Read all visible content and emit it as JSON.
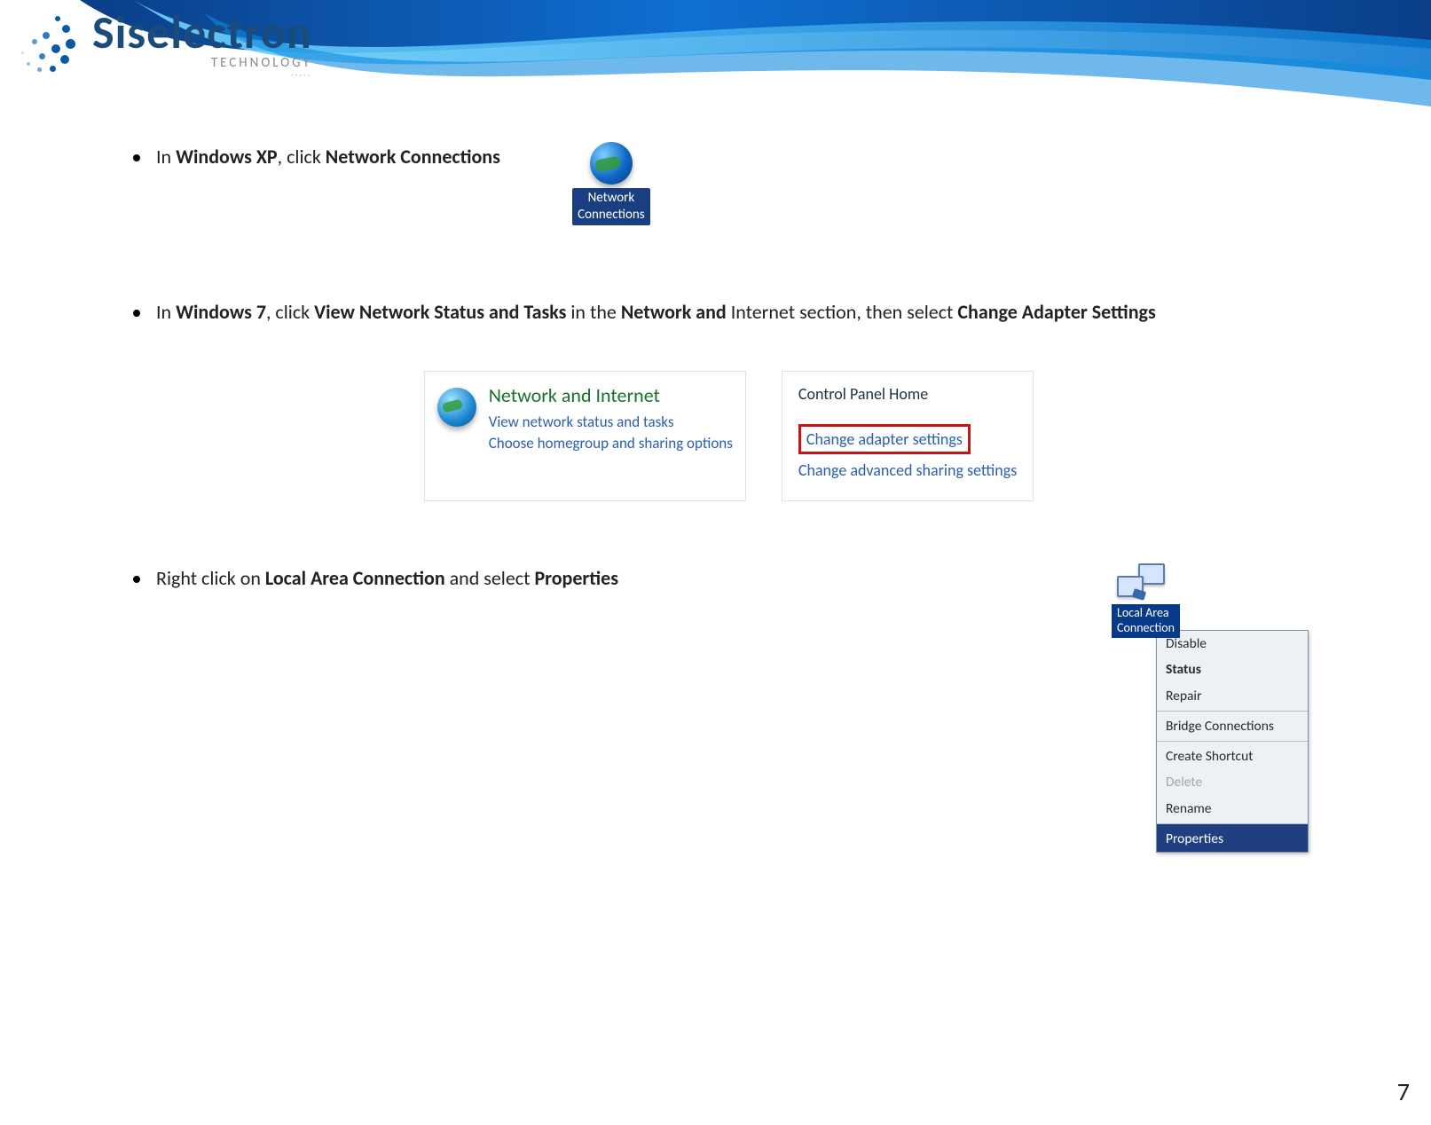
{
  "brand": {
    "name": "Siselectron",
    "sub": "TECHNOLOGY",
    "dots": "·····"
  },
  "bullet1": {
    "pre": "In ",
    "os": "Windows XP",
    "mid": ", click ",
    "target": "Network Connections"
  },
  "xp_icon": {
    "label": "Network\nConnections"
  },
  "bullet2": {
    "pre": "In ",
    "os": "Windows 7",
    "mid1": ", click ",
    "b1": "View Network Status and Tasks",
    "mid2": " in the ",
    "b2": "Network and",
    "tail1": " Internet section, then select ",
    "b3": "Change Adapter Settings"
  },
  "ni_panel": {
    "heading": "Network and Internet",
    "link1": "View network status and tasks",
    "link2": "Choose homegroup and sharing options"
  },
  "cp_panel": {
    "title": "Control Panel Home",
    "highlight": "Change adapter settings",
    "other": "Change advanced sharing settings"
  },
  "bullet3": {
    "pre": "Right click on ",
    "b1": "Local Area Connection",
    "mid": " and select ",
    "b2": "Properties"
  },
  "lac": {
    "label": "Local Area\nConnection"
  },
  "context_menu": {
    "items": [
      {
        "label": "Disable",
        "bold": false,
        "disabled": false,
        "sep": false,
        "selected": false
      },
      {
        "label": "Status",
        "bold": true,
        "disabled": false,
        "sep": false,
        "selected": false
      },
      {
        "label": "Repair",
        "bold": false,
        "disabled": false,
        "sep": false,
        "selected": false
      },
      {
        "label": "Bridge Connections",
        "bold": false,
        "disabled": false,
        "sep": true,
        "selected": false
      },
      {
        "label": "Create Shortcut",
        "bold": false,
        "disabled": false,
        "sep": true,
        "selected": false
      },
      {
        "label": "Delete",
        "bold": false,
        "disabled": true,
        "sep": false,
        "selected": false
      },
      {
        "label": "Rename",
        "bold": false,
        "disabled": false,
        "sep": false,
        "selected": false
      },
      {
        "label": "Properties",
        "bold": false,
        "disabled": false,
        "sep": true,
        "selected": true
      }
    ]
  },
  "page_number": "7"
}
